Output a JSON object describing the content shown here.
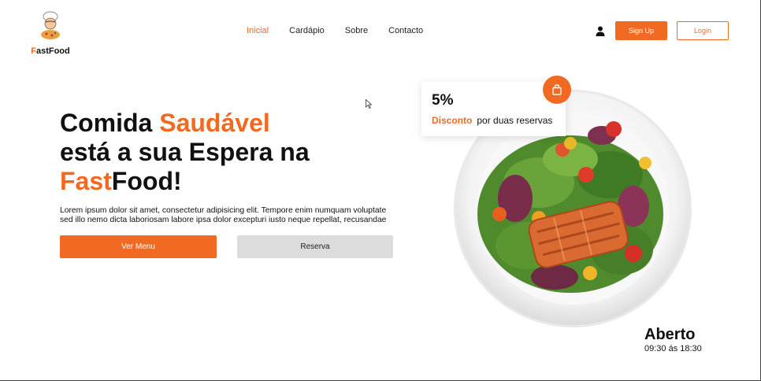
{
  "brand": {
    "prefix": "F",
    "suffix": "astFood"
  },
  "nav": {
    "items": [
      "Inicial",
      "Cardápio",
      "Sobre",
      "Contacto"
    ]
  },
  "auth": {
    "signup_label": "Sign Up",
    "login_label": "Login"
  },
  "hero": {
    "title_part1": "Comida ",
    "title_highlight1": "Saudável",
    "title_line2": "está a sua Espera na",
    "title_highlight2": "Fast",
    "title_part3": "Food!",
    "description": "Lorem ipsum dolor sit amet, consectetur adipisicing elit. Tempore enim numquam voluptate sed illo nemo dicta laboriosam labore ipsa dolor excepturi iusto neque repellat, recusandae",
    "menu_button": "Ver Menu",
    "reserve_button": "Reserva"
  },
  "promo": {
    "percent": "5%",
    "discount_label": "Disconto",
    "detail": "por duas reservas"
  },
  "hours": {
    "title": "Aberto",
    "time": "09:30 ás 18:30"
  },
  "colors": {
    "accent": "#f26a21",
    "secondary_button": "#dcdcdc"
  },
  "icons": {
    "logo": "chef-logo-icon",
    "user": "user-icon",
    "bag": "shopping-bag-icon",
    "plate": "salmon-salad-plate"
  }
}
